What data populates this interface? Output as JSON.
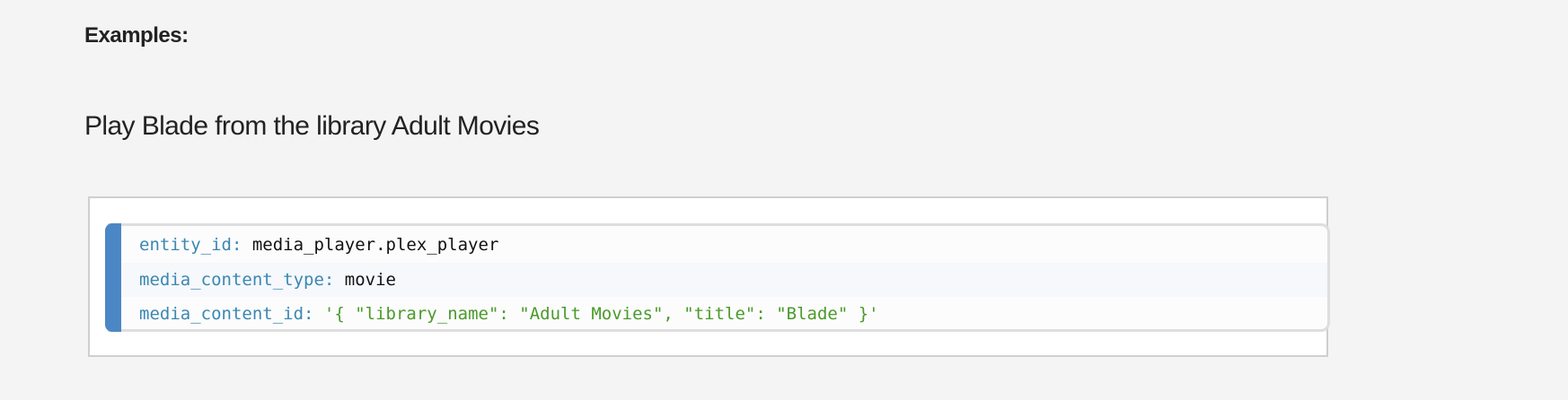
{
  "heading": "Examples:",
  "description": "Play Blade from the library Adult Movies",
  "code": {
    "lines": [
      {
        "key": "entity_id",
        "sep": ": ",
        "value": "media_player.plex_player"
      },
      {
        "key": "media_content_type",
        "sep": ": ",
        "value": "movie"
      },
      {
        "key": "media_content_id",
        "sep": ": ",
        "value": "'{ \"library_name\": \"Adult Movies\", \"title\": \"Blade\" }'"
      }
    ]
  },
  "colors": {
    "key": "#3b87b3",
    "string": "#4a9a2a",
    "accent_bar": "#4c87c5"
  }
}
